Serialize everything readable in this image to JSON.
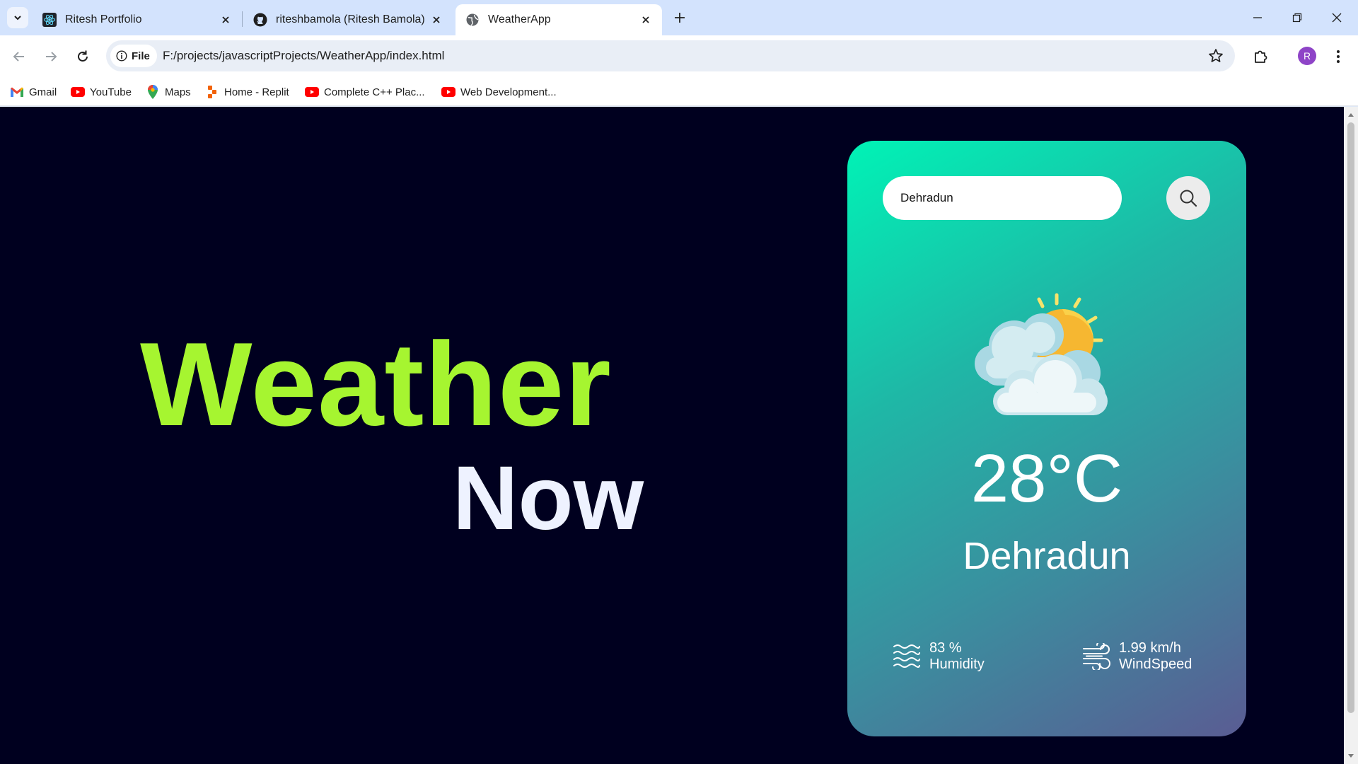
{
  "browser": {
    "tabs": [
      {
        "title": "Ritesh Portfolio",
        "favicon": "react-icon"
      },
      {
        "title": "riteshbamola (Ritesh Bamola)",
        "favicon": "github-icon"
      },
      {
        "title": "WeatherApp",
        "favicon": "globe-icon",
        "active": true
      }
    ],
    "site_chip": "File",
    "url": "F:/projects/javascriptProjects/WeatherApp/index.html",
    "profile_initial": "R"
  },
  "bookmarks": [
    {
      "label": "Gmail",
      "icon": "gmail-icon"
    },
    {
      "label": "YouTube",
      "icon": "youtube-icon"
    },
    {
      "label": "Maps",
      "icon": "maps-icon"
    },
    {
      "label": "Home - Replit",
      "icon": "replit-icon"
    },
    {
      "label": "Complete C++ Plac...",
      "icon": "youtube-icon"
    },
    {
      "label": "Web Development...",
      "icon": "youtube-icon"
    }
  ],
  "hero": {
    "line1": "Weather",
    "line2": "Now"
  },
  "weather": {
    "search_value": "Dehradun",
    "temperature": "28°C",
    "city": "Dehradun",
    "humidity_value": "83 %",
    "humidity_label": "Humidity",
    "wind_value": "1.99 km/h",
    "wind_label": "WindSpeed",
    "icon": "partly-cloudy-sun-icon"
  },
  "colors": {
    "page_bg": "#00001f",
    "hero_accent": "#a6f530",
    "hero_secondary": "#eef2ff",
    "card_gradient_start": "#00f3b6",
    "card_gradient_end": "#5a5c93"
  }
}
